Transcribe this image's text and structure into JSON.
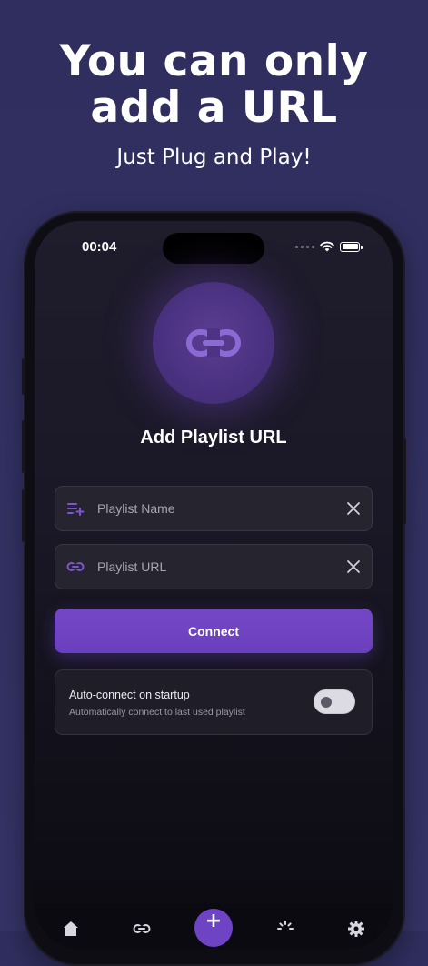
{
  "marketing": {
    "headline_line1": "You can only",
    "headline_line2": "add a URL",
    "subline": "Just Plug and Play!"
  },
  "status_bar": {
    "time": "00:04",
    "icons": [
      "signal-dots-icon",
      "wifi-icon",
      "battery-icon"
    ]
  },
  "screen": {
    "hero_icon": "link-icon",
    "title": "Add Playlist URL"
  },
  "form": {
    "playlist_name": {
      "placeholder": "Playlist Name",
      "value": "",
      "icon": "playlist-add-icon"
    },
    "playlist_url": {
      "placeholder": "Playlist URL",
      "value": "",
      "icon": "link-icon"
    },
    "connect_label": "Connect"
  },
  "auto_connect": {
    "title": "Auto-connect on startup",
    "subtitle": "Automatically connect to last used playlist",
    "enabled": false
  },
  "tab_bar": {
    "items": [
      "home-icon",
      "link-icon",
      "add-icon",
      "loading-icon",
      "settings-icon"
    ],
    "fab_symbol": "+"
  },
  "colors": {
    "background": "#2f2e5e",
    "accent": "#6e43c4",
    "screen_bg": "#1a1826"
  }
}
